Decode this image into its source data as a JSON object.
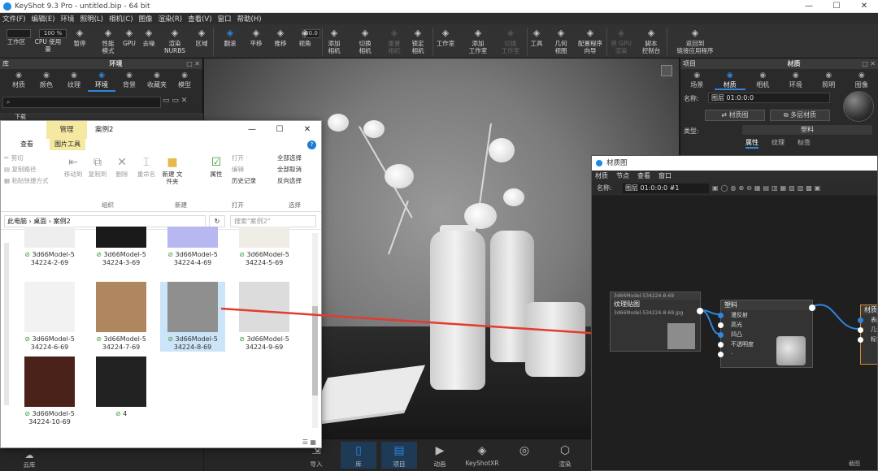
{
  "window": {
    "title": "KeyShot 9.3 Pro - untitled.bip - 64 bit",
    "controls": [
      "—",
      "☐",
      "✕"
    ]
  },
  "menubar": [
    "文件(F)",
    "编辑(E)",
    "环境",
    "照明(L)",
    "相机(C)",
    "图像",
    "渲染(R)",
    "查看(V)",
    "窗口",
    "帮助(H)"
  ],
  "toolbar": {
    "cpu_value": "100 %",
    "focal_value": "50.0",
    "items": [
      {
        "label": "工作区",
        "icon": "workspace-icon"
      },
      {
        "label": "CPU 使用量",
        "icon": "cpu-icon"
      },
      {
        "label": "暂停",
        "icon": "pause-icon"
      },
      {
        "label": "性能\n模式",
        "icon": "performance-icon"
      },
      {
        "label": "GPU",
        "icon": "gpu-icon"
      },
      {
        "label": "去噪",
        "icon": "denoise-icon"
      },
      {
        "label": "渲染\nNURBS",
        "icon": "nurbs-icon"
      },
      {
        "label": "区域",
        "icon": "region-icon"
      },
      {
        "label": "翻滚",
        "icon": "tumble-icon",
        "active": true
      },
      {
        "label": "平移",
        "icon": "pan-icon"
      },
      {
        "label": "推移",
        "icon": "dolly-icon"
      },
      {
        "label": "视角",
        "icon": "view-icon"
      },
      {
        "label": "添加\n相机",
        "icon": "add-camera-icon"
      },
      {
        "label": "切换\n相机",
        "icon": "switch-camera-icon"
      },
      {
        "label": "重置\n相机",
        "icon": "reset-camera-icon",
        "dim": true
      },
      {
        "label": "锁定\n相机",
        "icon": "lock-camera-icon"
      },
      {
        "label": "工作室",
        "icon": "studio-icon"
      },
      {
        "label": "添加\n工作室",
        "icon": "add-studio-icon"
      },
      {
        "label": "切换\n工作室",
        "icon": "switch-studio-icon",
        "dim": true
      },
      {
        "label": "工具",
        "icon": "tools-icon"
      },
      {
        "label": "几何\n视图",
        "icon": "geometry-view-icon"
      },
      {
        "label": "配置程序\n向导",
        "icon": "configurator-icon"
      },
      {
        "label": "将 GPU\n渲染",
        "icon": "gpu-render-icon",
        "dim": true
      },
      {
        "label": "脚本\n控制台",
        "icon": "script-icon"
      },
      {
        "label": "返回到\n链接应用程序",
        "icon": "return-link-icon"
      }
    ]
  },
  "library": {
    "header": {
      "left": "库",
      "center": "环境",
      "right": "□ ✕"
    },
    "tabs": [
      {
        "label": "材质",
        "icon": "material-icon"
      },
      {
        "label": "颜色",
        "icon": "color-icon"
      },
      {
        "label": "纹理",
        "icon": "texture-icon"
      },
      {
        "label": "环境",
        "icon": "environment-icon",
        "active": true
      },
      {
        "label": "背景",
        "icon": "background-icon"
      },
      {
        "label": "收藏夹",
        "icon": "favorites-icon"
      },
      {
        "label": "模型",
        "icon": "model-icon"
      }
    ],
    "search_placeholder": "⌕",
    "row_label": "下载",
    "cloud_label": "云库"
  },
  "explorer": {
    "manage_tab": "管理",
    "title": "案例2",
    "tabs": [
      "查看",
      "图片工具"
    ],
    "help": "?",
    "ribbon": {
      "clipboard": [
        "剪切",
        "复制路径",
        "粘贴快捷方式"
      ],
      "big_buttons": [
        "移动到",
        "复制到",
        "删除",
        "重命名",
        "新建\n文件夹",
        "属性"
      ],
      "open": [
        "打开 ·",
        "编辑",
        "历史记录"
      ],
      "select": [
        "全部选择",
        "全部取消",
        "反向选择"
      ],
      "groups": [
        "组织",
        "新建",
        "打开",
        "选择"
      ]
    },
    "address": "此电脑 › 桌面 › 案例2",
    "search_placeholder": "搜索\"案例2\"",
    "files": [
      {
        "name": "3d66Model-5\n34224-2-69",
        "color": "#eeeeee"
      },
      {
        "name": "3d66Model-5\n34224-3-69",
        "color": "#1a1a1a"
      },
      {
        "name": "3d66Model-5\n34224-4-69",
        "color": "#b7b8f2"
      },
      {
        "name": "3d66Model-5\n34224-5-69",
        "color": "#f0ece6"
      },
      {
        "name": "3d66Model-5\n34224-6-69",
        "color": "#f2f2f2"
      },
      {
        "name": "3d66Model-5\n34224-7-69",
        "color": "#b08660"
      },
      {
        "name": "3d66Model-5\n34224-8-69",
        "color": "#8f8f8f",
        "selected": true
      },
      {
        "name": "3d66Model-5\n34224-9-69",
        "color": "#dcdcdc"
      },
      {
        "name": "3d66Model-5\n34224-10-69",
        "color": "#4a2219"
      },
      {
        "name": "4",
        "color": "#222222"
      }
    ]
  },
  "project": {
    "header": {
      "left": "项目",
      "center": "材质",
      "right": "□ ✕"
    },
    "tabs": [
      {
        "label": "场景",
        "icon": "scene-icon"
      },
      {
        "label": "材质",
        "icon": "material-icon",
        "active": true
      },
      {
        "label": "相机",
        "icon": "camera-icon"
      },
      {
        "label": "环境",
        "icon": "environment-icon"
      },
      {
        "label": "照明",
        "icon": "lighting-icon"
      },
      {
        "label": "图像",
        "icon": "image-icon"
      }
    ],
    "name_label": "名称:",
    "name_value": "图层 01:0:0:0",
    "material_graph_btn": "材质图",
    "multi_material_btn": "多层材质",
    "type_label": "类型:",
    "type_value": "塑料",
    "sub_tabs": [
      "属性",
      "纹理",
      "标签"
    ]
  },
  "material_graph": {
    "title": "材质图",
    "menu": [
      "材质",
      "节点",
      "查看",
      "窗口"
    ],
    "name_label": "名称:",
    "name_value": "图层 01:0:0:0 #1",
    "texture_node": {
      "header": "3d66Model-534224-8-69",
      "title": "纹理贴图",
      "file": "3d66Model-534224-8-69.jpg"
    },
    "plastic_node": {
      "title": "塑料",
      "ports": [
        "漫反射",
        "高光",
        "凹凸",
        "不透明度",
        "·"
      ]
    },
    "material_node": {
      "title": "材质",
      "ports": [
        "表面",
        "几何",
        "标签"
      ]
    }
  },
  "bottom_bar": [
    {
      "label": "导入",
      "icon": "import-icon"
    },
    {
      "label": "库",
      "icon": "library-icon",
      "active": true
    },
    {
      "label": "项目",
      "icon": "project-icon",
      "active": true
    },
    {
      "label": "动画",
      "icon": "animation-icon"
    },
    {
      "label": "KeyShotXR",
      "icon": "keyshotxr-icon"
    },
    {
      "label": "",
      "icon": "vr-icon"
    },
    {
      "label": "渲染",
      "icon": "render-icon"
    }
  ],
  "corner_label": "截图"
}
